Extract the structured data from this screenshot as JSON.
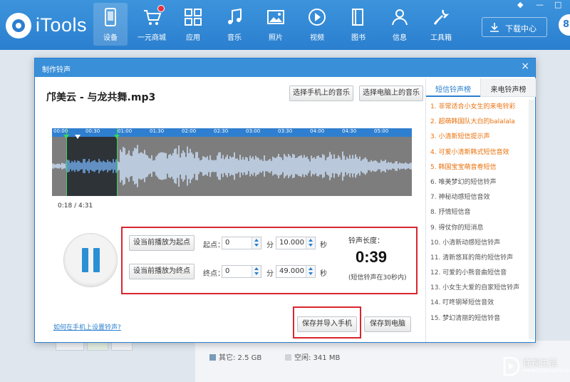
{
  "app": {
    "name": "iTools"
  },
  "nav": [
    {
      "label": "设备",
      "icon": "device-icon",
      "active": true
    },
    {
      "label": "一元商城",
      "icon": "cart-icon",
      "badge": true
    },
    {
      "label": "应用",
      "icon": "apps-icon"
    },
    {
      "label": "音乐",
      "icon": "music-icon"
    },
    {
      "label": "照片",
      "icon": "photo-icon"
    },
    {
      "label": "视频",
      "icon": "video-icon"
    },
    {
      "label": "图书",
      "icon": "book-icon"
    },
    {
      "label": "信息",
      "icon": "contact-icon"
    },
    {
      "label": "工具箱",
      "icon": "tools-icon"
    }
  ],
  "window_controls": [
    "◆",
    "—",
    "□"
  ],
  "download_center": {
    "label": "下载中心"
  },
  "user_initial": "8",
  "background": {
    "legend_other": "其它: 2.5 GB",
    "legend_free": "空闲: 341 MB",
    "colors": {
      "other": "#7a9bb8",
      "free": "#d0d4d8"
    }
  },
  "watermark": {
    "line1": "懂视生活",
    "line2": "www.51dongshi.com"
  },
  "dialog": {
    "title": "制作铃声",
    "close": "×",
    "song_title": "邝美云 - 与龙共舞.mp3",
    "btn_choose_phone": "选择手机上的音乐",
    "btn_choose_pc": "选择电脑上的音乐",
    "timeline_ticks": [
      "00:00",
      "00:30",
      "01:00",
      "01:30",
      "02:00",
      "02:30",
      "03:00",
      "03:30",
      "04:00",
      "04:30",
      "05:00"
    ],
    "current_time": "0:18 / 4:31",
    "btn_set_start": "设当前播放为起点",
    "btn_set_end": "设当前播放为终点",
    "start_label": "起点：",
    "end_label": "终点：",
    "start_min": "0",
    "start_sec": "10.000",
    "end_min": "0",
    "end_sec": "49.000",
    "min_unit": "分",
    "sec_unit": "秒",
    "length_title": "铃声长度：",
    "length_value": "0:39",
    "length_note": "(短信铃声在30秒内)",
    "help_link": "如何在手机上设置铃声?",
    "btn_save_import": "保存并导入手机",
    "btn_save_pc": "保存到电脑"
  },
  "ringtone_panel": {
    "tab_sms": "短信铃声榜",
    "tab_call": "来电铃声榜",
    "items": [
      "1. 非常适合小女生的来电铃彩",
      "2. 超萌韩国队大白的balalala",
      "3. 小清新短信提示声",
      "4. 可爱小清新韩式短信音效",
      "5. 韩国宝宝萌音卷短信",
      "6. 唯美梦幻的短信铃声",
      "7. 神秘动感短信音效",
      "8. 抒情短信音",
      "9. 得仗你的短消息",
      "10. 小清新动感短信铃声",
      "11. 清新悠耳的简约短信铃声",
      "12. 可爱的小熊音曲短信音",
      "13. 小女生大爱的自家短信铃声",
      "14. 叮咚钢琴短信音效",
      "15. 梦幻清丽的短信铃音"
    ],
    "number_colors": {
      "top": "#e8700b",
      "rest": "#888888"
    }
  }
}
